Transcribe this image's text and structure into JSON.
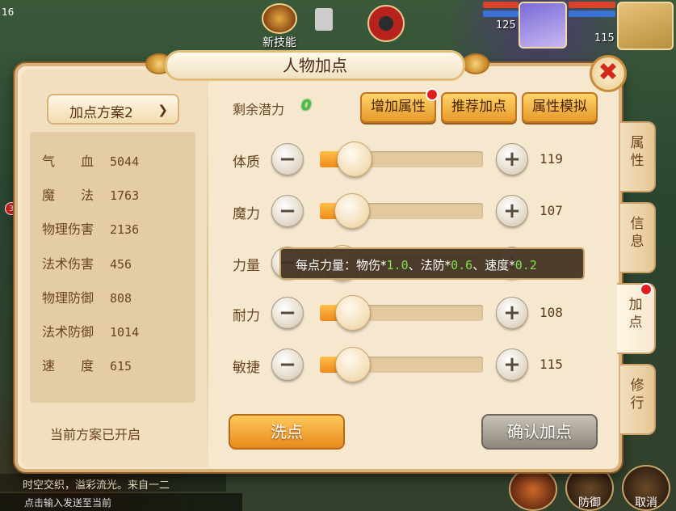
{
  "title": "人物加点",
  "hud": {
    "level_corner": "16",
    "new_skill_label": "新技能",
    "hero_level": "125",
    "pet_level": "115",
    "notif_count": "3",
    "chat_line": "时空交织，溢彩流光。来自一二",
    "chat_input_placeholder": "点击输入发送至当前",
    "defend_label": "防御",
    "cancel_label": "取消"
  },
  "scheme": {
    "name": "加点方案2",
    "status": "当前方案已开启"
  },
  "stats": [
    {
      "name": "气　　血",
      "value": "5044"
    },
    {
      "name": "魔　　法",
      "value": "1763"
    },
    {
      "name": "物理伤害",
      "value": "2136"
    },
    {
      "name": "法术伤害",
      "value": "456"
    },
    {
      "name": "物理防御",
      "value": "808"
    },
    {
      "name": "法术防御",
      "value": "1014"
    },
    {
      "name": "速　　度",
      "value": "615"
    }
  ],
  "potential": {
    "label": "剩余潜力",
    "value": "0"
  },
  "top_buttons": {
    "add_attr": "增加属性",
    "recommend": "推荐加点",
    "simulate": "属性模拟"
  },
  "attributes": [
    {
      "label": "体质",
      "value": "119",
      "level": 0.15
    },
    {
      "label": "魔力",
      "value": "107",
      "level": 0.12
    },
    {
      "label": "力量",
      "value": "",
      "level": 0.0
    },
    {
      "label": "耐力",
      "value": "108",
      "level": 0.13
    },
    {
      "label": "敏捷",
      "value": "115",
      "level": 0.13
    }
  ],
  "tooltip": {
    "prefix": "每点力量：物伤*",
    "phys": "1.0",
    "mid1": "、法防*",
    "mdef": "0.6",
    "mid2": "、速度*",
    "speed": "0.2"
  },
  "buttons": {
    "wash": "洗点",
    "confirm": "确认加点",
    "close": "✖"
  },
  "side_tabs": [
    "属性",
    "信息",
    "加点",
    "修行"
  ],
  "colors": {
    "accent_orange": "#f08a18",
    "potential_green": "#3fc43a",
    "tooltip_value_green": "#7ee34a",
    "close_red": "#d42a1a"
  }
}
